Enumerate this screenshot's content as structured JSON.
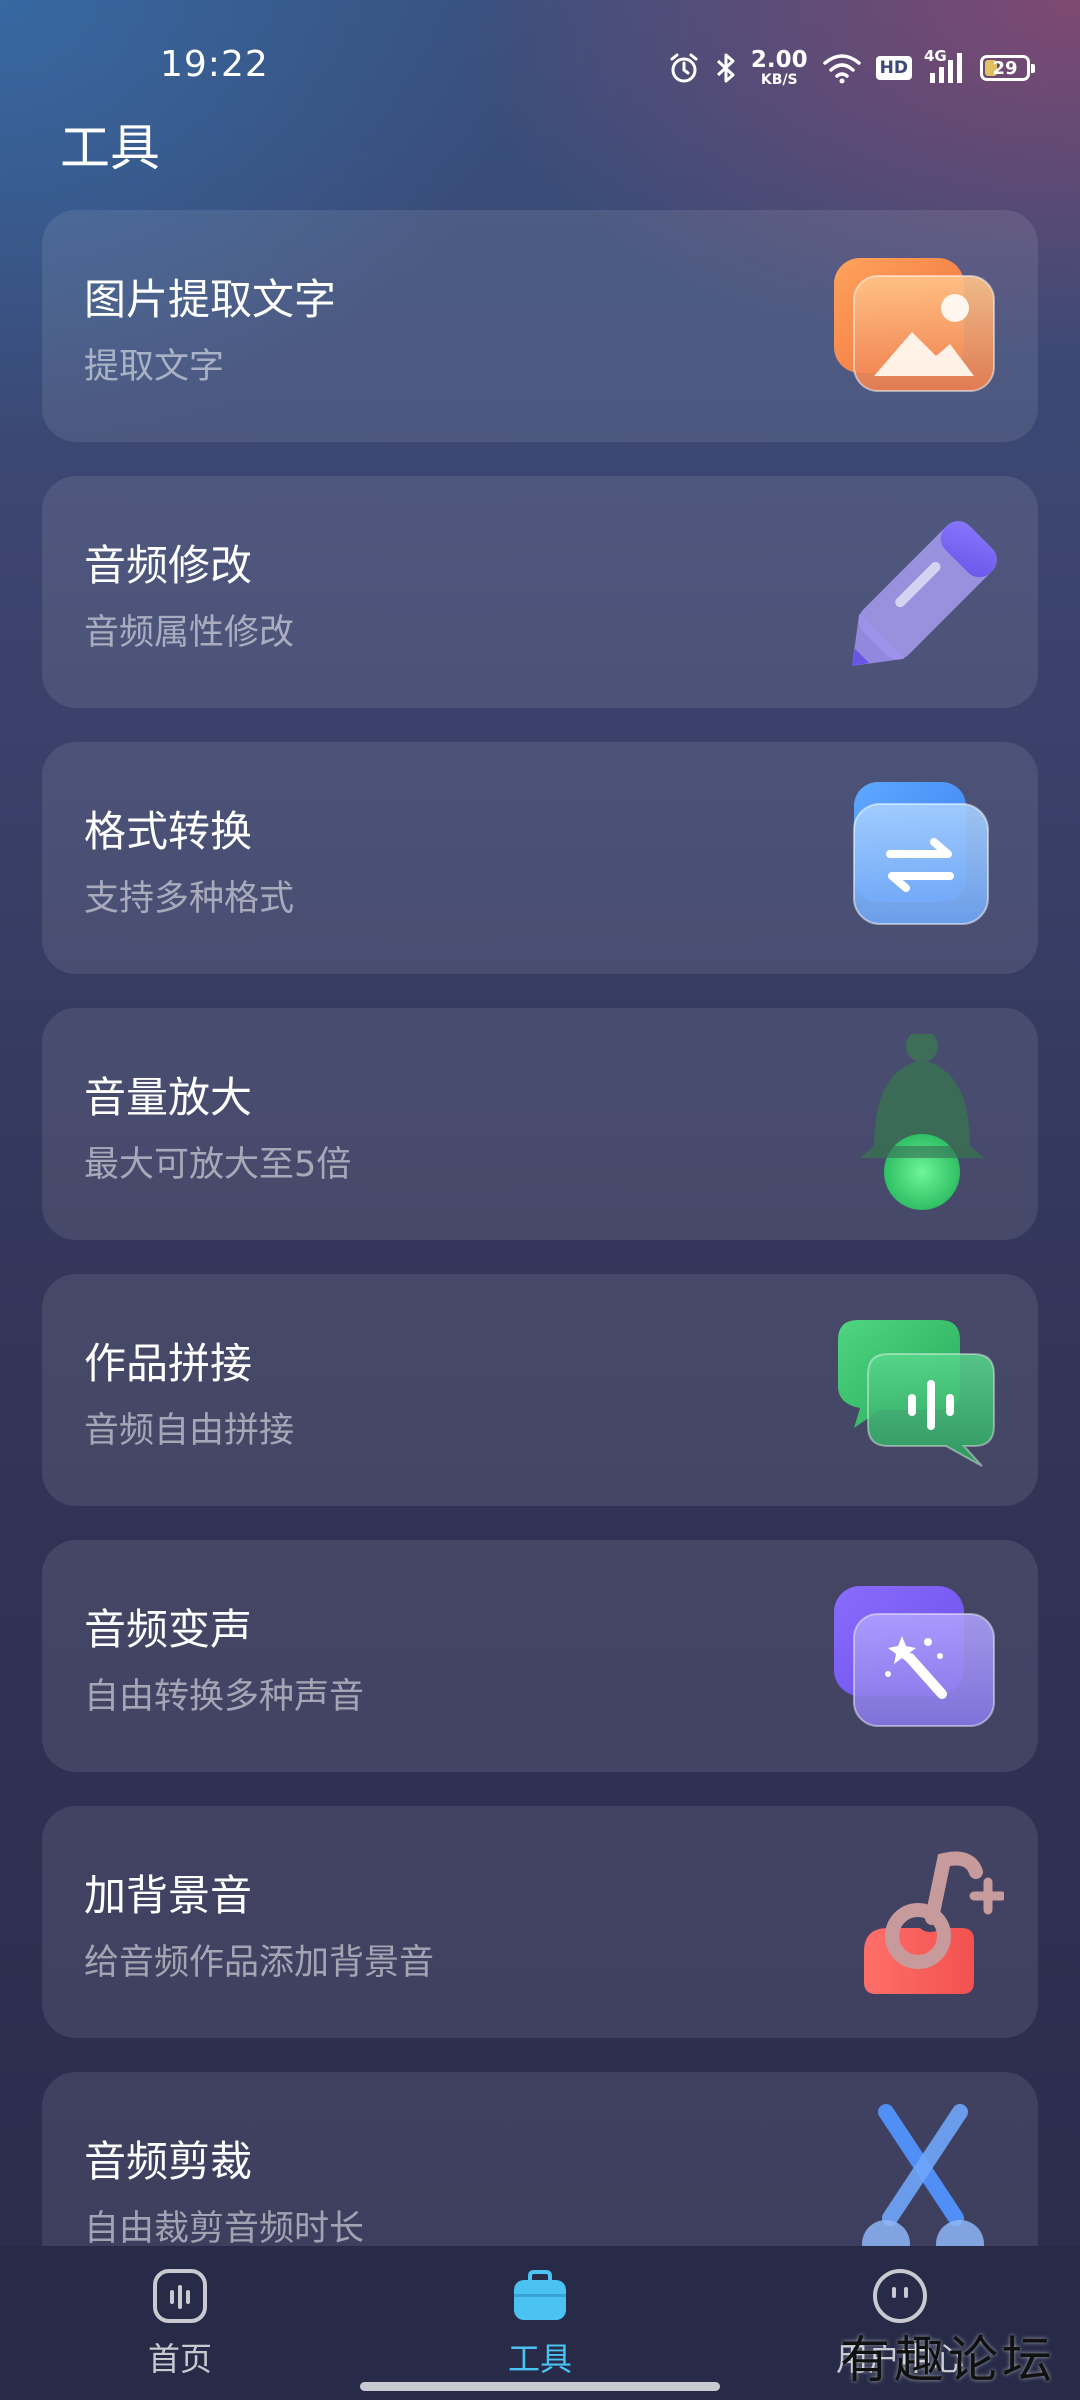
{
  "status_bar": {
    "time": "19:22",
    "net_speed_value": "2.00",
    "net_speed_unit": "KB/S",
    "hd_label": "HD",
    "network_label": "4G",
    "battery_level": "29",
    "icons": [
      "alarm-icon",
      "bluetooth-icon",
      "wifi-icon",
      "signal-icon",
      "battery-icon"
    ]
  },
  "page": {
    "title": "工具"
  },
  "tools": [
    {
      "title": "图片提取文字",
      "subtitle": "提取文字",
      "icon": "image-icon"
    },
    {
      "title": "音频修改",
      "subtitle": "音频属性修改",
      "icon": "pencil-icon"
    },
    {
      "title": "格式转换",
      "subtitle": "支持多种格式",
      "icon": "convert-icon"
    },
    {
      "title": "音量放大",
      "subtitle": "最大可放大至5倍",
      "icon": "bell-icon"
    },
    {
      "title": "作品拼接",
      "subtitle": "音频自由拼接",
      "icon": "chat-icon"
    },
    {
      "title": "音频变声",
      "subtitle": "自由转换多种声音",
      "icon": "magic-wand-icon"
    },
    {
      "title": "加背景音",
      "subtitle": "给音频作品添加背景音",
      "icon": "music-note-add-icon"
    },
    {
      "title": "音频剪裁",
      "subtitle": "自由裁剪音频时长",
      "icon": "scissors-icon"
    }
  ],
  "bottom_nav": {
    "items": [
      {
        "label": "首页",
        "icon": "home-waveform-icon",
        "active": false
      },
      {
        "label": "工具",
        "icon": "toolbox-icon",
        "active": true
      },
      {
        "label": "用户中心",
        "icon": "user-face-icon",
        "active": false
      }
    ]
  },
  "watermark": "有趣论坛",
  "colors": {
    "accent": "#4bc3f2",
    "card_bg": "rgba(255,255,255,0.095)",
    "nav_bg": "#272b47"
  }
}
